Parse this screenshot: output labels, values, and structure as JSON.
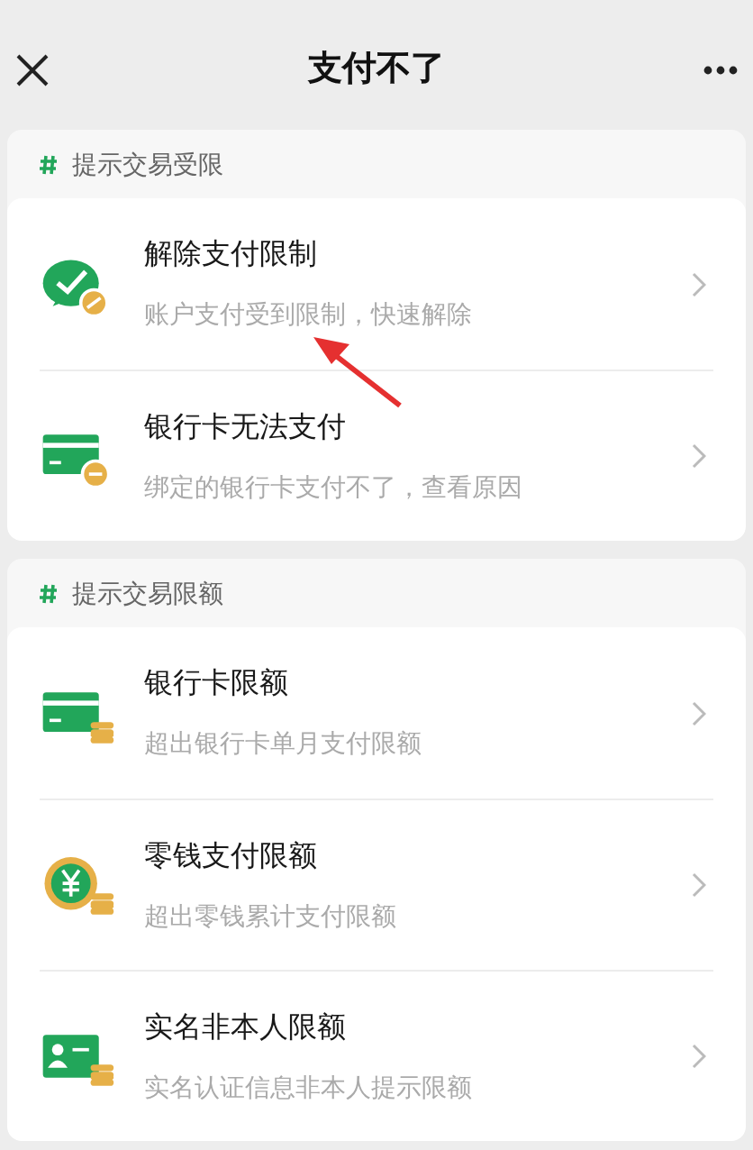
{
  "header": {
    "title": "支付不了"
  },
  "sections": [
    {
      "title": "提示交易受限",
      "items": [
        {
          "kind": "restricted",
          "title": "解除支付限制",
          "subtitle": "账户支付受到限制，快速解除"
        },
        {
          "kind": "card",
          "title": "银行卡无法支付",
          "subtitle": "绑定的银行卡支付不了，查看原因"
        }
      ]
    },
    {
      "title": "提示交易限额",
      "items": [
        {
          "kind": "cardlimit",
          "title": "银行卡限额",
          "subtitle": "超出银行卡单月支付限额"
        },
        {
          "kind": "walletlimit",
          "title": "零钱支付限额",
          "subtitle": "超出零钱累计支付限额"
        },
        {
          "kind": "namelimit",
          "title": "实名非本人限额",
          "subtitle": "实名认证信息非本人提示限额"
        }
      ]
    }
  ]
}
